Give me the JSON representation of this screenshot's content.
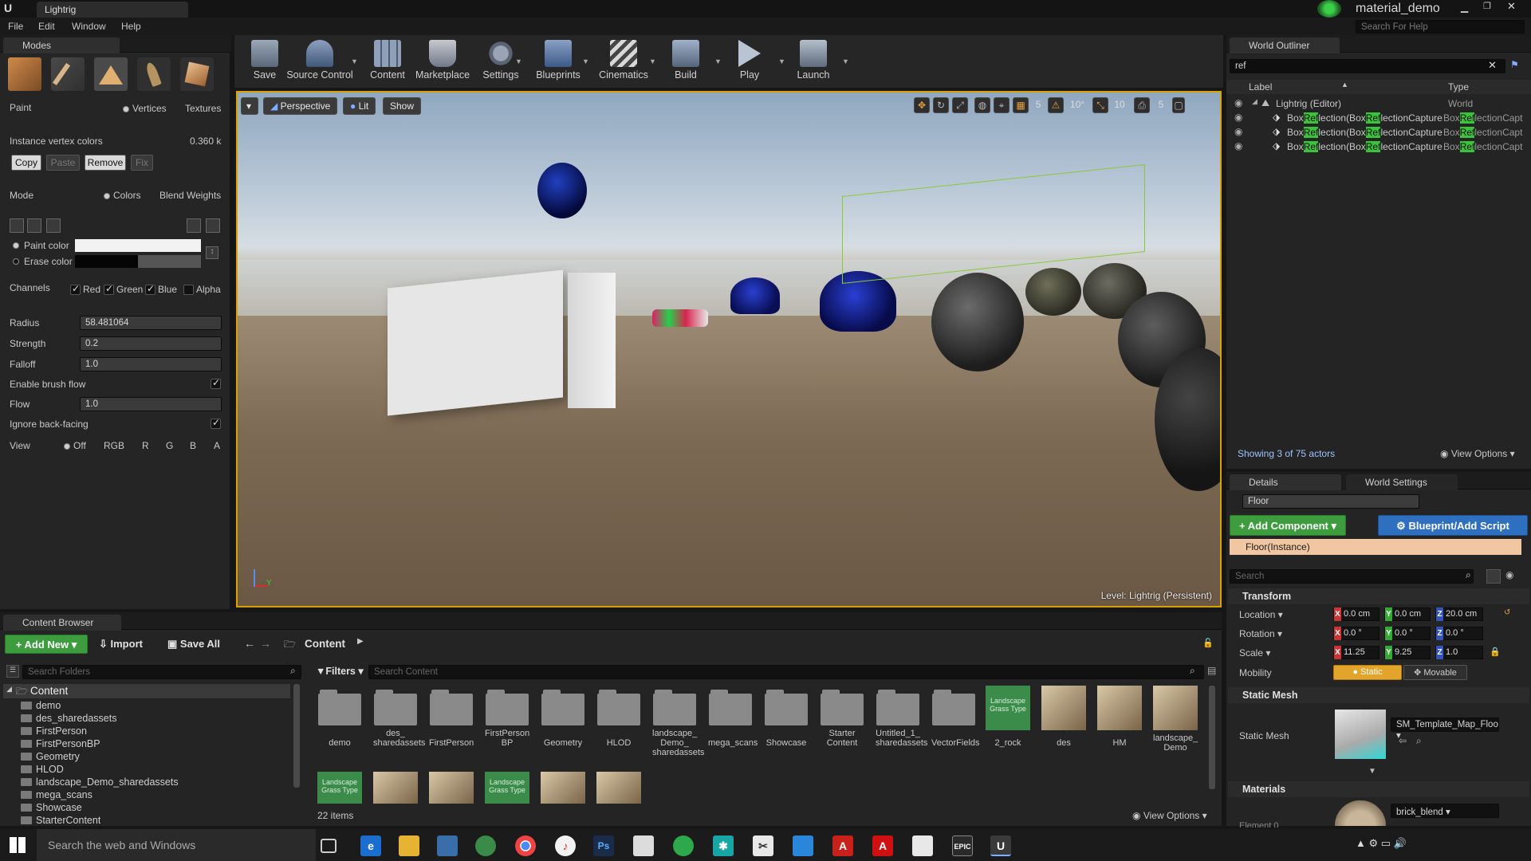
{
  "window": {
    "tab_title": "Lightrig",
    "project_name": "material_demo",
    "search_help_placeholder": "Search For Help"
  },
  "menu": [
    "File",
    "Edit",
    "Window",
    "Help"
  ],
  "modes": {
    "tab_label": "Modes",
    "paint_label": "Paint",
    "vertices_label": "Vertices",
    "textures_label": "Textures",
    "instance_vertex_colors_label": "Instance vertex colors",
    "instance_vertex_colors_value": "0.360 k",
    "buttons": [
      "Copy",
      "Paste",
      "Remove",
      "Fix"
    ],
    "mode_label": "Mode",
    "colors_label": "Colors",
    "blend_weights_label": "Blend Weights",
    "paint_color_label": "Paint color",
    "erase_color_label": "Erase color",
    "channels_label": "Channels",
    "channels": [
      "Red",
      "Green",
      "Blue",
      "Alpha"
    ],
    "radius_label": "Radius",
    "radius_value": "58.481064",
    "strength_label": "Strength",
    "strength_value": "0.2",
    "falloff_label": "Falloff",
    "falloff_value": "1.0",
    "enable_brush_flow_label": "Enable brush flow",
    "flow_label": "Flow",
    "flow_value": "1.0",
    "ignore_back_facing_label": "Ignore back-facing",
    "view_label": "View",
    "view_options": [
      "Off",
      "RGB",
      "R",
      "G",
      "B",
      "A"
    ]
  },
  "toolbar": {
    "buttons": [
      "Save",
      "Source Control",
      "Content",
      "Marketplace",
      "Settings",
      "Blueprints",
      "Cinematics",
      "Build",
      "Play",
      "Launch"
    ]
  },
  "viewport": {
    "perspective": "Perspective",
    "lit": "Lit",
    "show": "Show",
    "grid_snap": "5",
    "rot_snap": "10°",
    "scale_snap": "10",
    "cam_speed": "5",
    "level_text": "Level:  Lightrig (Persistent)"
  },
  "outliner": {
    "tab_label": "World Outliner",
    "search_value": "ref",
    "col_label": "Label",
    "col_type": "Type",
    "root_label": "Lightrig (Editor)",
    "root_type": "World",
    "rows": [
      {
        "pre": "Box",
        "hl": "Ref",
        "mid": "lection(Box",
        "hl2": "Ref",
        "post": "lectionCapture",
        "type_pre": "Box",
        "type_hl": "Ref",
        "type_post": "lectionCapt"
      },
      {
        "pre": "Box",
        "hl": "Ref",
        "mid": "lection(Box",
        "hl2": "Ref",
        "post": "lectionCapture",
        "type_pre": "Box",
        "type_hl": "Ref",
        "type_post": "lectionCapt"
      },
      {
        "pre": "Box",
        "hl": "Ref",
        "mid": "lection(Box",
        "hl2": "Ref",
        "post": "lectionCapture",
        "type_pre": "Box",
        "type_hl": "Ref",
        "type_post": "lectionCapt"
      }
    ],
    "showing": "Showing 3 of 75 actors",
    "view_options": "View Options"
  },
  "details": {
    "tab_details": "Details",
    "tab_world_settings": "World Settings",
    "actor_name": "Floor",
    "add_component": "Add Component",
    "blueprint_script": "Blueprint/Add Script",
    "instance_label": "Floor(Instance)",
    "search_placeholder": "Search",
    "transform_label": "Transform",
    "location_label": "Location",
    "location": [
      "0.0 cm",
      "0.0 cm",
      "20.0 cm"
    ],
    "rotation_label": "Rotation",
    "rotation": [
      "0.0 °",
      "0.0 °",
      "0.0 °"
    ],
    "scale_label": "Scale",
    "scale": [
      "11.25",
      "9.25",
      "1.0"
    ],
    "mobility_label": "Mobility",
    "mobility_static": "Static",
    "mobility_movable": "Movable",
    "static_mesh_section": "Static Mesh",
    "static_mesh_label": "Static Mesh",
    "static_mesh_value": "SM_Template_Map_Floo",
    "materials_section": "Materials",
    "material_value": "brick_blend",
    "element_label": "Element 0"
  },
  "content_browser": {
    "tab_label": "Content Browser",
    "add_new": "Add New",
    "import": "Import",
    "save_all": "Save All",
    "path_root": "Content",
    "search_folders_placeholder": "Search Folders",
    "filters": "Filters",
    "search_content_placeholder": "Search Content",
    "tree_root": "Content",
    "tree": [
      "demo",
      "des_sharedassets",
      "FirstPerson",
      "FirstPersonBP",
      "Geometry",
      "HLOD",
      "landscape_Demo_sharedassets",
      "mega_scans",
      "Showcase",
      "StarterContent"
    ],
    "folders": [
      "demo",
      "des_\nsharedassets",
      "FirstPerson",
      "FirstPerson\nBP",
      "Geometry",
      "HLOD",
      "landscape_\nDemo_\nsharedassets",
      "mega_scans",
      "Showcase",
      "Starter\nContent",
      "Untitled_1_\nsharedassets",
      "VectorFields"
    ],
    "assets": [
      "2_rock",
      "des",
      "HM",
      "landscape_\nDemo"
    ],
    "grass_type_label": "Landscape\nGrass Type",
    "items_count": "22 items",
    "view_options": "View Options"
  },
  "taskbar": {
    "search_placeholder": "Search the web and Windows"
  },
  "colors": {
    "accent_green": "#3bc43b",
    "add_component_green": "#3d9c3d",
    "blueprint_blue": "#2f6fbf",
    "static_orange": "#e2a42a"
  }
}
